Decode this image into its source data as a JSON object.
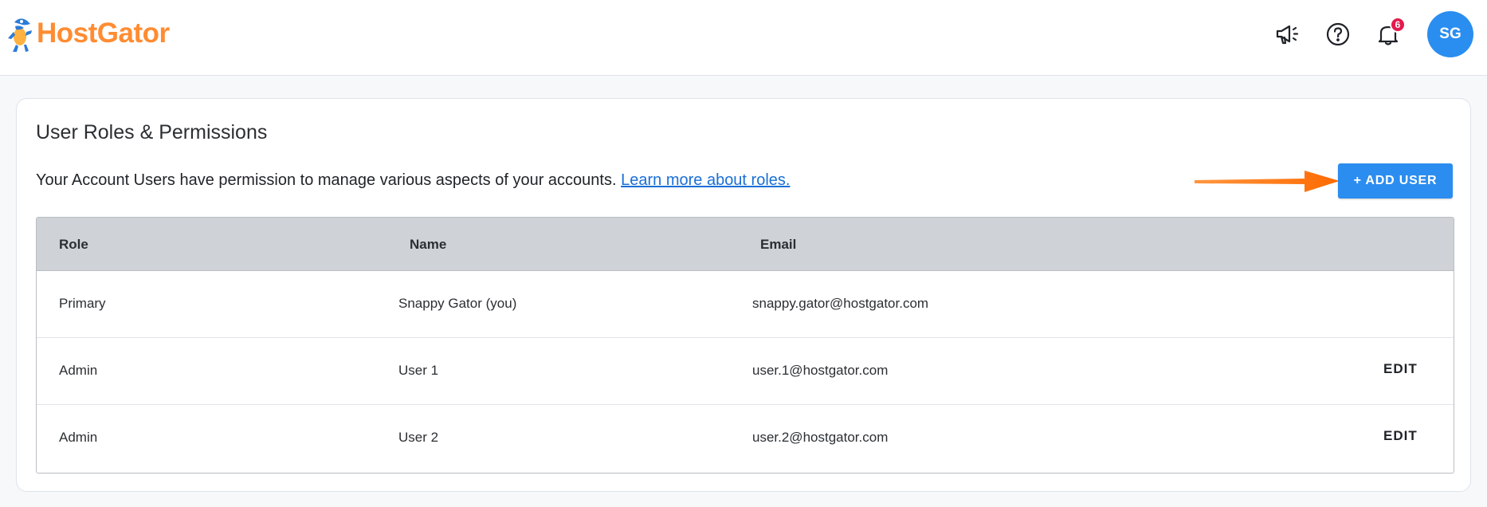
{
  "header": {
    "brand": "HostGator",
    "notifications_count": "6",
    "avatar_initials": "SG",
    "icons": [
      "megaphone-icon",
      "help-circle-icon",
      "bell-icon"
    ]
  },
  "card": {
    "title": "User Roles & Permissions",
    "description": "Your Account Users have permission to manage various aspects of your accounts.",
    "learn_more_link": "Learn more about roles.",
    "add_user_label": "+ ADD USER"
  },
  "table": {
    "columns": [
      "Role",
      "Name",
      "Email"
    ],
    "rows": [
      {
        "role": "Primary",
        "name": "Snappy Gator (you)",
        "email": "snappy.gator@hostgator.com",
        "action": ""
      },
      {
        "role": "Admin",
        "name": "User 1",
        "email": "user.1@hostgator.com",
        "action": "EDIT"
      },
      {
        "role": "Admin",
        "name": "User 2",
        "email": "user.2@hostgator.com",
        "action": "EDIT"
      }
    ]
  },
  "colors": {
    "brand_orange": "#ff8c32",
    "primary_blue": "#2b8df0",
    "link_blue": "#1a6fd6",
    "badge_red": "#e5194c",
    "table_header_bg": "#cfd2d7"
  }
}
